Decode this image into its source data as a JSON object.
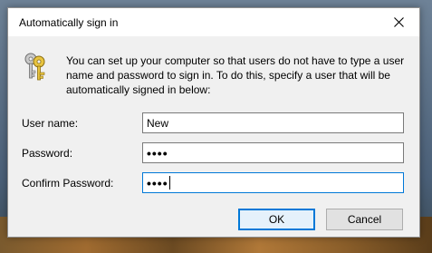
{
  "window": {
    "title": "Automatically sign in",
    "close_icon": "close-icon"
  },
  "description": "You can set up your computer so that users do not have to type a user name and password to sign in. To do this, specify a user that will be automatically signed in below:",
  "icon": "keys-icon",
  "fields": {
    "user_name_label": "User name:",
    "user_name_value": "New",
    "password_label": "Password:",
    "password_value": "••••",
    "confirm_password_label": "Confirm Password:",
    "confirm_password_value": "••••"
  },
  "buttons": {
    "ok_label": "OK",
    "cancel_label": "Cancel"
  },
  "colors": {
    "accent": "#0078d7",
    "dialog_bg": "#f0f0f0",
    "button_bg": "#e1e1e1"
  }
}
